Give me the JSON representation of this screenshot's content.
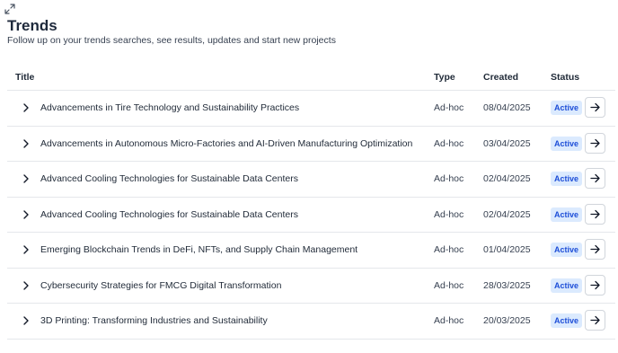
{
  "header": {
    "expand_icon": "expand-icon",
    "title": "Trends",
    "subtitle": "Follow up on your trends searches, see results, updates and start new projects"
  },
  "table": {
    "columns": {
      "title": "Title",
      "type": "Type",
      "created": "Created",
      "status": "Status"
    },
    "rows": [
      {
        "title": "Advancements in Tire Technology and Sustainability Practices",
        "type": "Ad-hoc",
        "created": "08/04/2025",
        "status": "Active"
      },
      {
        "title": "Advancements in Autonomous Micro-Factories and AI-Driven Manufacturing Optimization",
        "type": "Ad-hoc",
        "created": "03/04/2025",
        "status": "Active"
      },
      {
        "title": "Advanced Cooling Technologies for Sustainable Data Centers",
        "type": "Ad-hoc",
        "created": "02/04/2025",
        "status": "Active"
      },
      {
        "title": "Advanced Cooling Technologies for Sustainable Data Centers",
        "type": "Ad-hoc",
        "created": "02/04/2025",
        "status": "Active"
      },
      {
        "title": "Emerging Blockchain Trends in DeFi, NFTs, and Supply Chain Management",
        "type": "Ad-hoc",
        "created": "01/04/2025",
        "status": "Active"
      },
      {
        "title": "Cybersecurity Strategies for FMCG Digital Transformation",
        "type": "Ad-hoc",
        "created": "28/03/2025",
        "status": "Active"
      },
      {
        "title": "3D Printing: Transforming Industries and Sustainability",
        "type": "Ad-hoc",
        "created": "20/03/2025",
        "status": "Active"
      }
    ],
    "row_icons": {
      "expand": "chevron-right-icon",
      "open": "arrow-right-icon"
    }
  },
  "colors": {
    "badge_bg": "#dbeafe",
    "badge_text": "#1d4ed8",
    "divider": "#e5e7eb",
    "title": "#1e293b"
  }
}
